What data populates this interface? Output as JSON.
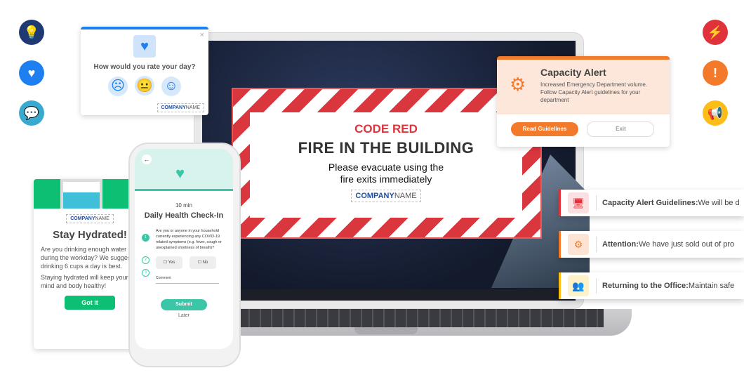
{
  "side_icons_left": [
    {
      "icon": "lightbulb-icon",
      "color": "#1f3a73"
    },
    {
      "icon": "heart-icon",
      "color": "#1e7ff0"
    },
    {
      "icon": "chat-icon",
      "color": "#3aa9cf"
    }
  ],
  "side_icons_right": [
    {
      "icon": "lightning-icon",
      "color": "#e0323b"
    },
    {
      "icon": "exclamation-icon",
      "color": "#f47a2b"
    },
    {
      "icon": "megaphone-icon",
      "color": "#fbbd16"
    }
  ],
  "rating": {
    "question": "How would you rate your day?",
    "faces": [
      "sad",
      "neutral",
      "happy"
    ],
    "brand_bold": "COMPANY",
    "brand_rest": "NAME"
  },
  "code_red": {
    "label": "CODE RED",
    "title": "FIRE IN THE BUILDING",
    "line1": "Please evacuate using the",
    "line2": "fire exits immediately",
    "brand_bold": "COMPANY",
    "brand_rest": "NAME"
  },
  "capacity": {
    "title": "Capacity Alert",
    "body": "Increased Emergency Department volume. Follow Capacity Alert guidelines for your department",
    "primary": "Read Guidelines",
    "secondary": "Exit",
    "accent": "#f47a2b"
  },
  "notifications": [
    {
      "bold": "Capacity Alert Guidelines:",
      "text": " We will be d",
      "color": "#e0323b",
      "icon": "monitor-code-icon"
    },
    {
      "bold": "Attention:",
      "text": " We have just sold out of pro",
      "color": "#f47a2b",
      "icon": "gears-icon"
    },
    {
      "bold": "Returning to the Office:",
      "text": " Maintain safe",
      "color": "#fbbd16",
      "icon": "people-icon"
    }
  ],
  "hydrate": {
    "brand_bold": "COMPANY",
    "brand_rest": "NAME",
    "title": "Stay Hydrated!",
    "p1": "Are you drinking enough water during the workday? We suggest drinking 6 cups a day is best.",
    "p2": "Staying hydrated will keep your mind and body healthy!",
    "button": "Got it",
    "accent": "#0cbf72"
  },
  "checkin": {
    "duration": "10 min",
    "title": "Daily Health Check-In",
    "question": "Are you or anyone in your household currently experiencing any COVID-19 related symptoms (e.g. fever, cough or unexplained shortness of breath)?",
    "steps": [
      "1",
      "2",
      "3"
    ],
    "yes": "Yes",
    "no": "No",
    "comment": "Comment",
    "submit": "Submit",
    "later": "Later",
    "accent": "#3cc6a8"
  }
}
